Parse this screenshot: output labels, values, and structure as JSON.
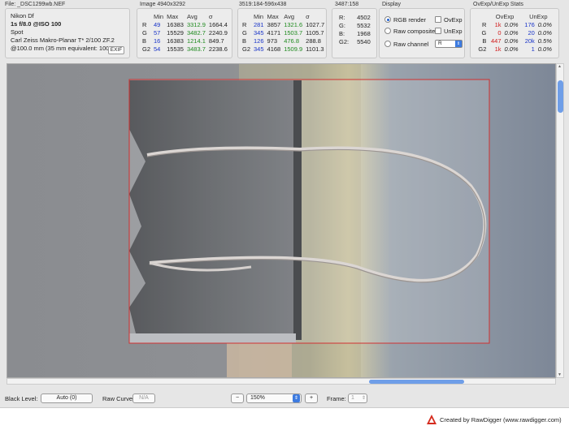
{
  "file_panel": {
    "title": "File: _DSC1299wb.NEF",
    "camera": "Nikon Df",
    "exposure": "1s f/8.0 @ISO 100",
    "metering": "Spot",
    "lens": "Carl Zeiss Makro-Planar T* 2/100 ZF.2",
    "focal": "@100.0 mm (35 mm equivalent: 100.0 mm)",
    "exif_label": "EXIF"
  },
  "image_panel": {
    "title": "Image 4940x3292",
    "headers": [
      "",
      "Min",
      "Max",
      "Avg",
      "σ"
    ],
    "rows": [
      {
        "ch": "R",
        "min": "49",
        "max": "16383",
        "avg": "3312.9",
        "sd": "1664.4"
      },
      {
        "ch": "G",
        "min": "57",
        "max": "15529",
        "avg": "3482.7",
        "sd": "2240.9"
      },
      {
        "ch": "B",
        "min": "16",
        "max": "16383",
        "avg": "1214.1",
        "sd": "849.7"
      },
      {
        "ch": "G2",
        "min": "54",
        "max": "15535",
        "avg": "3483.7",
        "sd": "2238.6"
      }
    ]
  },
  "selection_panel": {
    "title": "3519:184-596x438",
    "headers": [
      "",
      "Min",
      "Max",
      "Avg",
      "σ"
    ],
    "rows": [
      {
        "ch": "R",
        "min": "281",
        "max": "3857",
        "avg": "1321.6",
        "sd": "1027.7"
      },
      {
        "ch": "G",
        "min": "345",
        "max": "4171",
        "avg": "1503.7",
        "sd": "1105.7"
      },
      {
        "ch": "B",
        "min": "126",
        "max": "973",
        "avg": "476.8",
        "sd": "288.8"
      },
      {
        "ch": "G2",
        "min": "345",
        "max": "4168",
        "avg": "1509.9",
        "sd": "1101.3"
      }
    ]
  },
  "pixel_panel": {
    "title": "3487:158",
    "rows": [
      {
        "ch": "R:",
        "val": "4502"
      },
      {
        "ch": "G:",
        "val": "5532"
      },
      {
        "ch": "B:",
        "val": "1968"
      },
      {
        "ch": "G2:",
        "val": "5540"
      }
    ]
  },
  "display_panel": {
    "title": "Display",
    "rgb_render": "RGB render",
    "raw_composite": "Raw composite",
    "raw_channel": "Raw channel",
    "ovexp": "OvExp",
    "unexp": "UnExp",
    "channel_value": "R"
  },
  "ovexp_panel": {
    "title": "OvExp/UnExp Stats",
    "headers": [
      "",
      "OvExp",
      "",
      "UnExp",
      ""
    ],
    "rows": [
      {
        "ch": "R",
        "ov": "1k",
        "ovp": "0.0%",
        "un": "176",
        "unp": "0.0%"
      },
      {
        "ch": "G",
        "ov": "0",
        "ovp": "0.0%",
        "un": "20",
        "unp": "0.0%"
      },
      {
        "ch": "B",
        "ov": "447",
        "ovp": "0.0%",
        "un": "20k",
        "unp": "0.5%"
      },
      {
        "ch": "G2",
        "ov": "1k",
        "ovp": "0.0%",
        "un": "1",
        "unp": "0.0%"
      }
    ]
  },
  "bottom": {
    "black_level_label": "Black Level:",
    "black_level_value": "Auto (0)",
    "raw_curve_label": "Raw Curve:",
    "raw_curve_value": "N/A",
    "zoom_minus": "−",
    "zoom_value": "150%",
    "zoom_plus": "+",
    "frame_label": "Frame:",
    "frame_value": "1"
  },
  "footer": {
    "credit": "Created by RawDigger (www.rawdigger.com)"
  },
  "colors": {
    "accent": "#3d7be0",
    "min_blue": "#1a35c8",
    "avg_green": "#1f8a1f",
    "overexp_red": "#d11a1a",
    "selection_outline": "#d03030"
  }
}
